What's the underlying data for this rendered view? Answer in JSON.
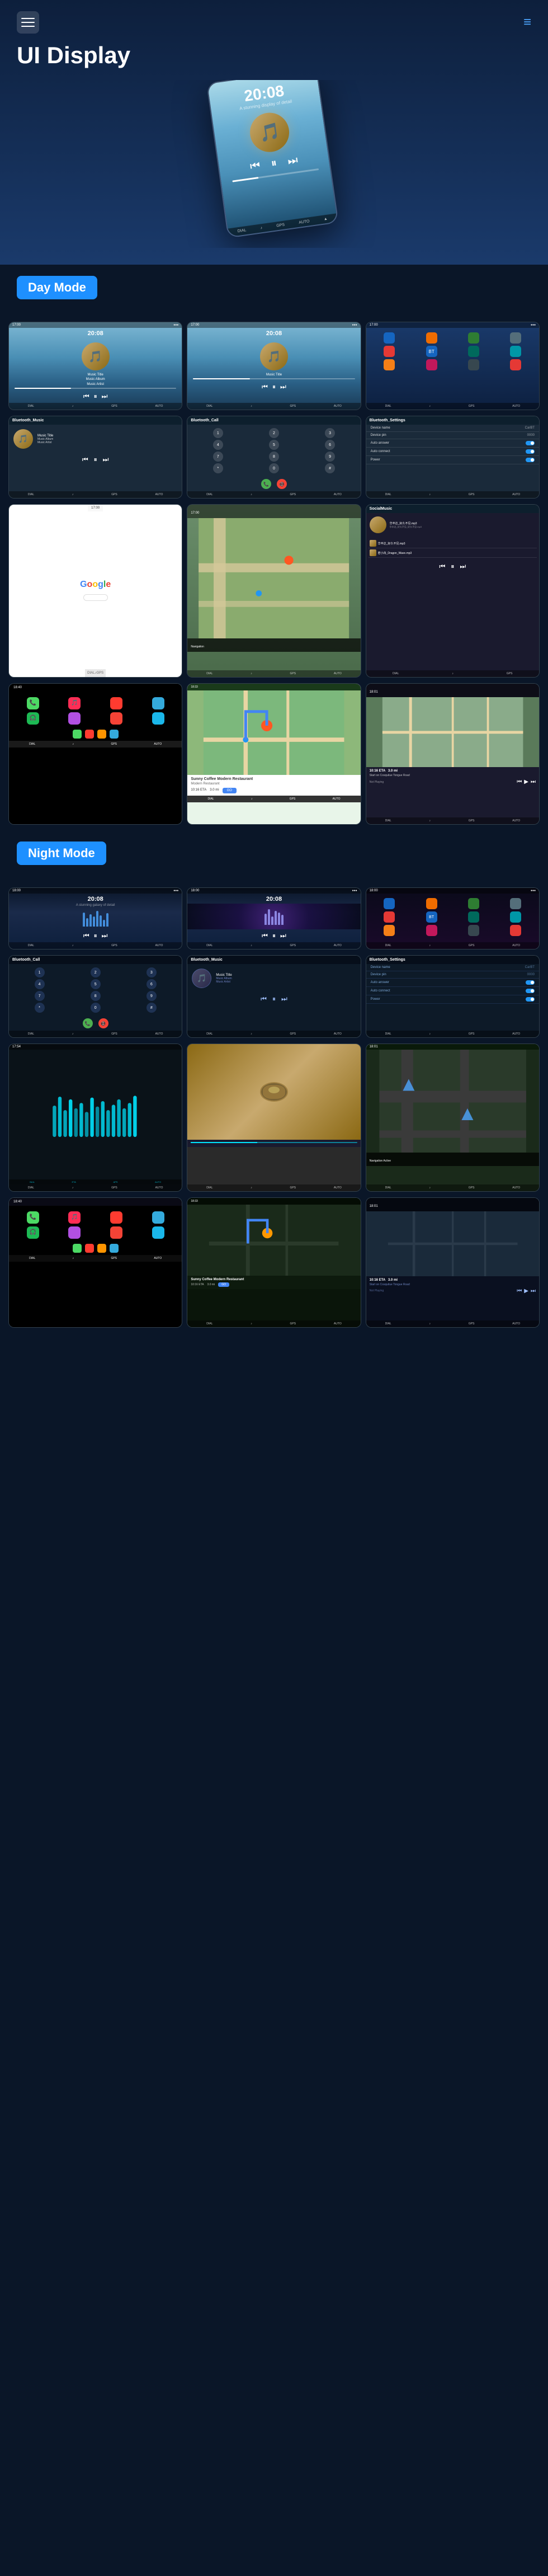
{
  "header": {
    "title": "UI Display",
    "menu_icon": "≡",
    "nav_icon": "≡"
  },
  "day_mode": {
    "label": "Day Mode",
    "screens": [
      {
        "type": "music_player",
        "time": "20:08",
        "subtitle": "Music Title",
        "note": "day music 1"
      },
      {
        "type": "music_player",
        "time": "20:08",
        "subtitle": "",
        "note": "day music 2"
      },
      {
        "type": "home_apps",
        "note": "day home screen"
      },
      {
        "type": "bluetooth_music",
        "title": "Bluetooth_Music",
        "note": "music info"
      },
      {
        "type": "bluetooth_call",
        "title": "Bluetooth_Call",
        "note": "call numpad"
      },
      {
        "type": "bluetooth_settings",
        "title": "Bluetooth_Settings",
        "note": "settings"
      },
      {
        "type": "google",
        "note": "google screen"
      },
      {
        "type": "navigation",
        "note": "navigation map"
      },
      {
        "type": "local_music",
        "title": "SocialMusic",
        "note": "local music list"
      }
    ]
  },
  "day_mode_row2": {
    "screens": [
      {
        "type": "carplay",
        "note": "apple carplay"
      },
      {
        "type": "waze_nav",
        "note": "waze navigation"
      },
      {
        "type": "not_playing",
        "note": "not playing music"
      }
    ]
  },
  "night_mode": {
    "label": "Night Mode",
    "screens": [
      {
        "type": "music_night",
        "time": "20:08",
        "note": "night music 1"
      },
      {
        "type": "music_night",
        "time": "20:08",
        "note": "night music 2"
      },
      {
        "type": "home_night",
        "note": "night home"
      },
      {
        "type": "bt_call_night",
        "title": "Bluetooth_Call",
        "note": "night call"
      },
      {
        "type": "bt_music_night",
        "title": "Bluetooth_Music",
        "note": "night music info"
      },
      {
        "type": "bt_settings_night",
        "title": "Bluetooth_Settings",
        "note": "night settings"
      },
      {
        "type": "eq_screen",
        "note": "equalizer"
      },
      {
        "type": "video_screen",
        "note": "video thumbnail"
      },
      {
        "type": "road_map_night",
        "note": "road map night"
      }
    ]
  },
  "night_mode_row2": {
    "screens": [
      {
        "type": "carplay_night",
        "note": "night carplay"
      },
      {
        "type": "waze_night",
        "note": "night waze"
      },
      {
        "type": "not_playing_night",
        "note": "night not playing"
      }
    ]
  },
  "music": {
    "title": "Music Title",
    "album": "Music Album",
    "artist": "Music Artist"
  },
  "settings": {
    "device_name_label": "Device name",
    "device_name_value": "CarBT",
    "device_pin_label": "Device pin",
    "device_pin_value": "0000",
    "auto_answer_label": "Auto answer",
    "auto_connect_label": "Auto connect",
    "power_label": "Power"
  },
  "coffee": {
    "title": "Sunny Coffee Modern Restaurant",
    "go_label": "GO",
    "eta_label": "10:16 ETA",
    "distance": "3.0 mi"
  },
  "not_playing": {
    "label": "Not Playing",
    "road_label": "Start on Cosquilue Tongue Road"
  }
}
